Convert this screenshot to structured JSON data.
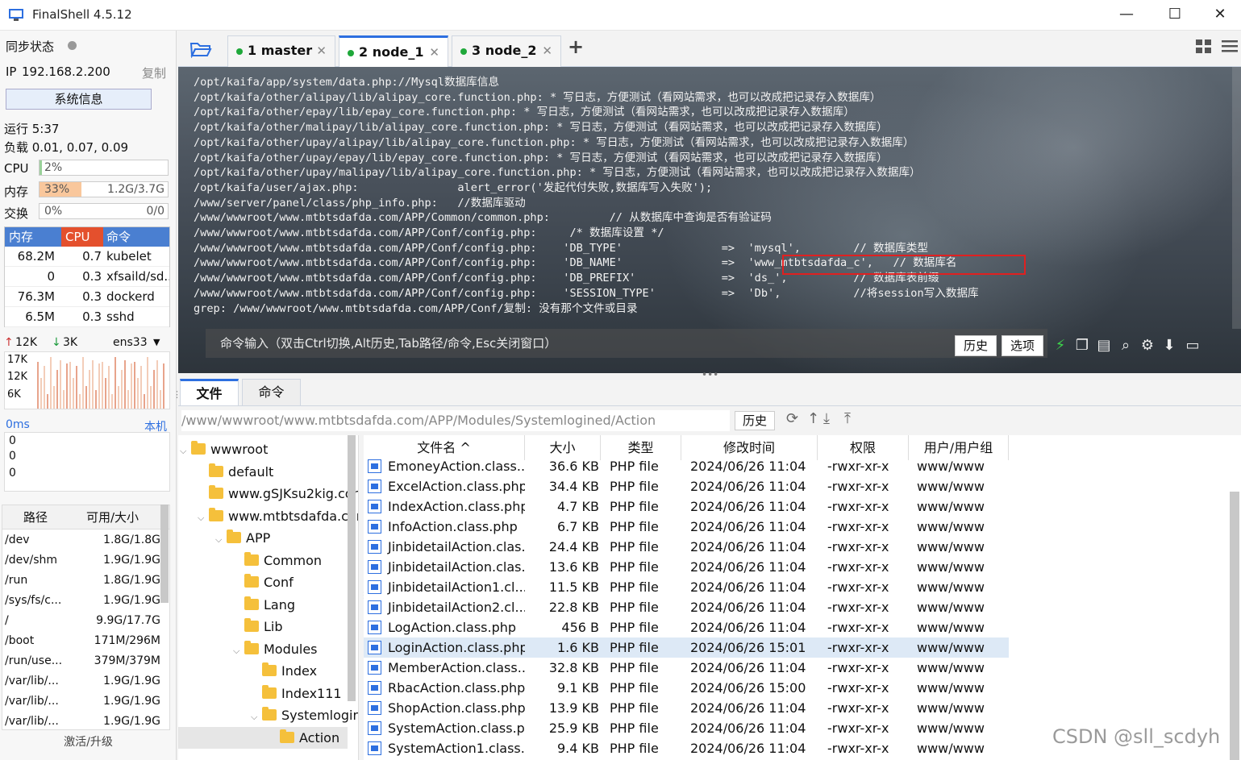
{
  "window": {
    "title": "FinalShell 4.5.12",
    "minimize": "—",
    "maximize": "☐",
    "close": "✕"
  },
  "left": {
    "sync_label": "同步状态",
    "ip_label": "IP",
    "ip": "192.168.2.200",
    "copy": "复制",
    "sysinfo_button": "系统信息",
    "uptime": "运行 5:37",
    "load": "负载 0.01, 0.07, 0.09",
    "cpu_label": "CPU",
    "cpu_value": "2%",
    "cpu_percent": 2,
    "mem_label": "内存",
    "mem_value": "33%",
    "mem_detail": "1.2G/3.7G",
    "mem_percent": 33,
    "swap_label": "交换",
    "swap_value": "0%",
    "swap_detail": "0/0",
    "proc_headers": [
      "内存",
      "CPU",
      "命令"
    ],
    "processes": [
      {
        "mem": "68.2M",
        "cpu": "0.7",
        "cmd": "kubelet"
      },
      {
        "mem": "0",
        "cpu": "0.3",
        "cmd": "xfsaild/sd..."
      },
      {
        "mem": "76.3M",
        "cpu": "0.3",
        "cmd": "dockerd"
      },
      {
        "mem": "6.5M",
        "cpu": "0.3",
        "cmd": "sshd"
      }
    ],
    "net_up": "12K",
    "net_down": "3K",
    "net_iface": "ens33",
    "net_scale": [
      "17K",
      "12K",
      "6K"
    ],
    "ping": "0ms",
    "ping_host": "本机",
    "ping_values": [
      "0",
      "0",
      "0"
    ],
    "disk_headers": [
      "路径",
      "可用/大小"
    ],
    "disks": [
      {
        "path": "/dev",
        "size": "1.8G/1.8G"
      },
      {
        "path": "/dev/shm",
        "size": "1.9G/1.9G"
      },
      {
        "path": "/run",
        "size": "1.8G/1.9G"
      },
      {
        "path": "/sys/fs/c...",
        "size": "1.9G/1.9G"
      },
      {
        "path": "/",
        "size": "9.9G/17.7G"
      },
      {
        "path": "/boot",
        "size": "171M/296M"
      },
      {
        "path": "/run/use...",
        "size": "379M/379M"
      },
      {
        "path": "/var/lib/...",
        "size": "1.9G/1.9G"
      },
      {
        "path": "/var/lib/...",
        "size": "1.9G/1.9G"
      },
      {
        "path": "/var/lib/...",
        "size": "1.9G/1.9G"
      }
    ],
    "activate": "激活/升级"
  },
  "tabs": [
    {
      "label": "1 master"
    },
    {
      "label": "2 node_1"
    },
    {
      "label": "3 node_2"
    }
  ],
  "tab_add": "+",
  "terminal": {
    "lines": [
      "/opt/kaifa/app/system/data.php://Mysql数据库信息",
      "/opt/kaifa/other/alipay/lib/alipay_core.function.php: * 写日志，方便测试（看网站需求，也可以改成把记录存入数据库）",
      "/opt/kaifa/other/epay/lib/epay_core.function.php: * 写日志，方便测试（看网站需求，也可以改成把记录存入数据库）",
      "/opt/kaifa/other/malipay/lib/alipay_core.function.php: * 写日志，方便测试（看网站需求，也可以改成把记录存入数据库）",
      "/opt/kaifa/other/upay/alipay/lib/alipay_core.function.php: * 写日志，方便测试（看网站需求，也可以改成把记录存入数据库）",
      "/opt/kaifa/other/upay/epay/lib/epay_core.function.php: * 写日志，方便测试（看网站需求，也可以改成把记录存入数据库）",
      "/opt/kaifa/other/upay/malipay/lib/alipay_core.function.php: * 写日志，方便测试（看网站需求，也可以改成把记录存入数据库）",
      "/opt/kaifa/user/ajax.php:               alert_error('发起代付失败,数据库写入失败');",
      "/www/server/panel/class/php_info.php:   //数据库驱动",
      "/www/wwwroot/www.mtbtsdafda.com/APP/Common/common.php:         // 从数据库中查询是否有验证码",
      "/www/wwwroot/www.mtbtsdafda.com/APP/Conf/config.php:     /* 数据库设置 */",
      "/www/wwwroot/www.mtbtsdafda.com/APP/Conf/config.php:    'DB_TYPE'               =>  'mysql',        // 数据库类型",
      "/www/wwwroot/www.mtbtsdafda.com/APP/Conf/config.php:    'DB_NAME'               =>  'www_mtbtsdafda_c',   // 数据库名",
      "/www/wwwroot/www.mtbtsdafda.com/APP/Conf/config.php:    'DB_PREFIX'             =>  'ds_',          // 数据库表前缀",
      "/www/wwwroot/www.mtbtsdafda.com/APP/Conf/config.php:    'SESSION_TYPE'          =>  'Db',           //将session写入数据库",
      "grep: /www/wwwroot/www.mtbtsdafda.com/APP/Conf/复制: 没有那个文件或目录"
    ],
    "cmd_placeholder": "命令输入（双击Ctrl切换,Alt历史,Tab路径/命令,Esc关闭窗口）",
    "history_btn": "历史",
    "options_btn": "选项",
    "highlight_color": "#e02020"
  },
  "bottom": {
    "tab_files": "文件",
    "tab_commands": "命令",
    "path": "/www/wwwroot/www.mtbtsdafda.com/APP/Modules/Systemlogined/Action",
    "history_btn": "历史"
  },
  "tree": [
    {
      "label": "wwwroot",
      "arrow": "⌵"
    },
    {
      "label": "default",
      "arrow": ""
    },
    {
      "label": "www.gSJKsu2kig.com",
      "arrow": ""
    },
    {
      "label": "www.mtbtsdafda.com",
      "arrow": "⌵"
    },
    {
      "label": "APP",
      "arrow": "⌵"
    },
    {
      "label": "Common",
      "arrow": ""
    },
    {
      "label": "Conf",
      "arrow": ""
    },
    {
      "label": "Lang",
      "arrow": ""
    },
    {
      "label": "Lib",
      "arrow": ""
    },
    {
      "label": "Modules",
      "arrow": "⌵"
    },
    {
      "label": "Index",
      "arrow": ""
    },
    {
      "label": "Index111",
      "arrow": ""
    },
    {
      "label": "Systemlogined",
      "arrow": "⌵"
    },
    {
      "label": "Action",
      "arrow": ""
    }
  ],
  "files": {
    "headers": [
      "文件名 ^",
      "大小",
      "类型",
      "修改时间",
      "权限",
      "用户/用户组"
    ],
    "rows": [
      {
        "name": "EmoneyAction.class....",
        "size": "36.6 KB",
        "type": "PHP file",
        "time": "2024/06/26 11:04",
        "perm": "-rwxr-xr-x",
        "owner": "www/www"
      },
      {
        "name": "ExcelAction.class.php",
        "size": "34.4 KB",
        "type": "PHP file",
        "time": "2024/06/26 11:04",
        "perm": "-rwxr-xr-x",
        "owner": "www/www"
      },
      {
        "name": "IndexAction.class.php",
        "size": "4.7 KB",
        "type": "PHP file",
        "time": "2024/06/26 11:04",
        "perm": "-rwxr-xr-x",
        "owner": "www/www"
      },
      {
        "name": "InfoAction.class.php",
        "size": "6.7 KB",
        "type": "PHP file",
        "time": "2024/06/26 11:04",
        "perm": "-rwxr-xr-x",
        "owner": "www/www"
      },
      {
        "name": "JinbidetailAction.clas...",
        "size": "24.4 KB",
        "type": "PHP file",
        "time": "2024/06/26 11:04",
        "perm": "-rwxr-xr-x",
        "owner": "www/www"
      },
      {
        "name": "JinbidetailAction.clas...",
        "size": "13.6 KB",
        "type": "PHP file",
        "time": "2024/06/26 11:04",
        "perm": "-rwxr-xr-x",
        "owner": "www/www"
      },
      {
        "name": "JinbidetailAction1.cl...",
        "size": "11.5 KB",
        "type": "PHP file",
        "time": "2024/06/26 11:04",
        "perm": "-rwxr-xr-x",
        "owner": "www/www"
      },
      {
        "name": "JinbidetailAction2.cl...",
        "size": "22.8 KB",
        "type": "PHP file",
        "time": "2024/06/26 11:04",
        "perm": "-rwxr-xr-x",
        "owner": "www/www"
      },
      {
        "name": "LogAction.class.php",
        "size": "456 B",
        "type": "PHP file",
        "time": "2024/06/26 11:04",
        "perm": "-rwxr-xr-x",
        "owner": "www/www"
      },
      {
        "name": "LoginAction.class.php",
        "size": "1.6 KB",
        "type": "PHP file",
        "time": "2024/06/26 15:01",
        "perm": "-rwxr-xr-x",
        "owner": "www/www"
      },
      {
        "name": "MemberAction.class....",
        "size": "32.8 KB",
        "type": "PHP file",
        "time": "2024/06/26 11:04",
        "perm": "-rwxr-xr-x",
        "owner": "www/www"
      },
      {
        "name": "RbacAction.class.php",
        "size": "9.1 KB",
        "type": "PHP file",
        "time": "2024/06/26 15:00",
        "perm": "-rwxr-xr-x",
        "owner": "www/www"
      },
      {
        "name": "ShopAction.class.php",
        "size": "13.9 KB",
        "type": "PHP file",
        "time": "2024/06/26 11:04",
        "perm": "-rwxr-xr-x",
        "owner": "www/www"
      },
      {
        "name": "SystemAction.class.p...",
        "size": "25.9 KB",
        "type": "PHP file",
        "time": "2024/06/26 11:04",
        "perm": "-rwxr-xr-x",
        "owner": "www/www"
      },
      {
        "name": "SystemAction1.class....",
        "size": "9.4 KB",
        "type": "PHP file",
        "time": "2024/06/26 11:04",
        "perm": "-rwxr-xr-x",
        "owner": "www/www"
      }
    ],
    "selected_index": 9
  },
  "watermark": "CSDN @sll_scdyh"
}
